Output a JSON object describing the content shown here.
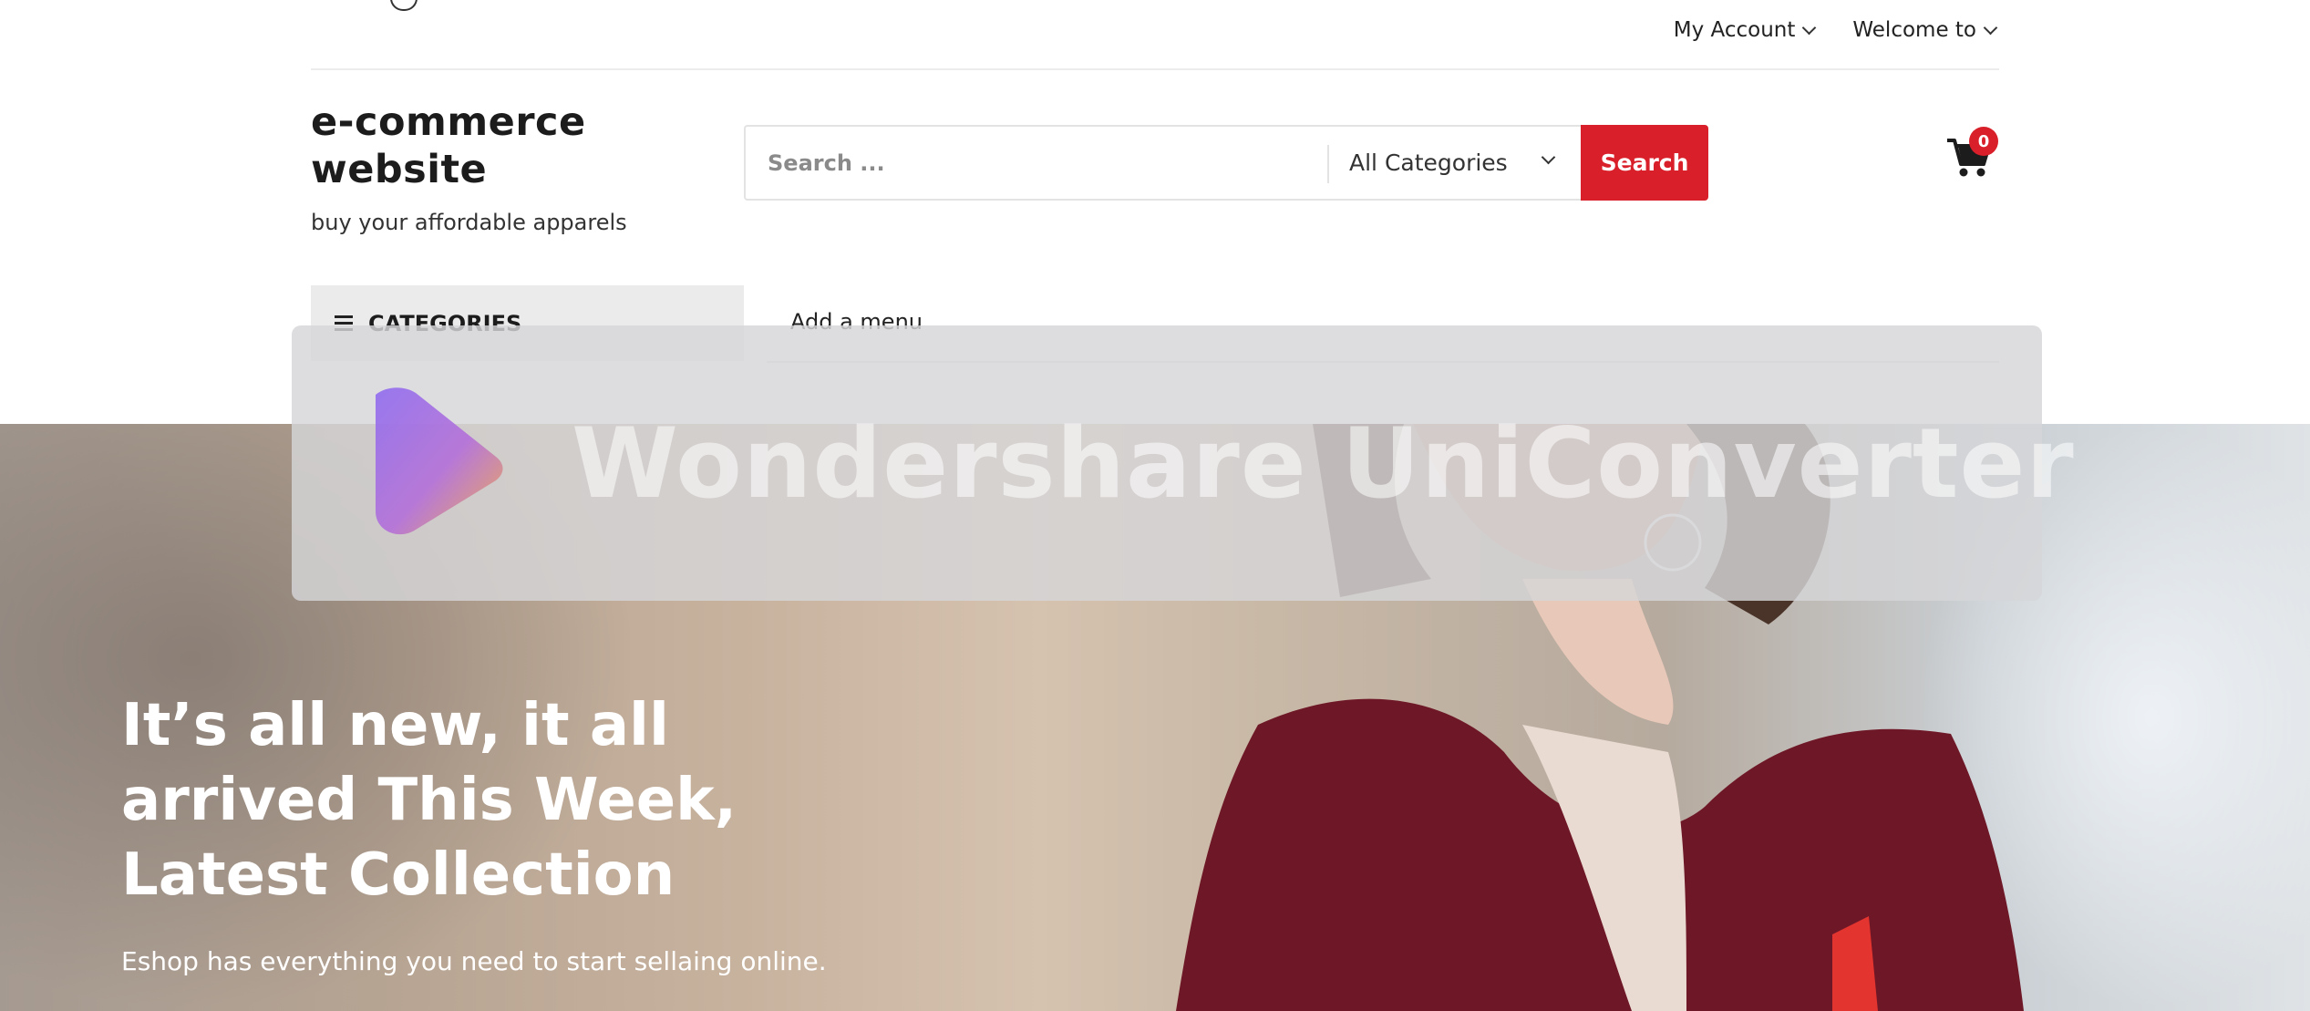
{
  "topbar": {
    "my_account": "My Account",
    "welcome": "Welcome to"
  },
  "brand": {
    "title": "e-commerce website",
    "tagline": "buy your affordable apparels"
  },
  "search": {
    "placeholder": "Search ...",
    "category": "All Categories",
    "button": "Search"
  },
  "cart": {
    "count": "0",
    "icon": "shopping-cart-icon"
  },
  "nav": {
    "categories": "CATEGORIES",
    "add_menu": "Add a menu"
  },
  "hero": {
    "title": "It’s all new, it all arrived This Week, Latest Collection",
    "subtitle": "Eshop has everything you need to start sellaing online."
  },
  "watermark": {
    "text": "Wondershare UniConverter"
  },
  "colors": {
    "accent": "#d91f2a",
    "nav_bg": "#ebebeb"
  }
}
